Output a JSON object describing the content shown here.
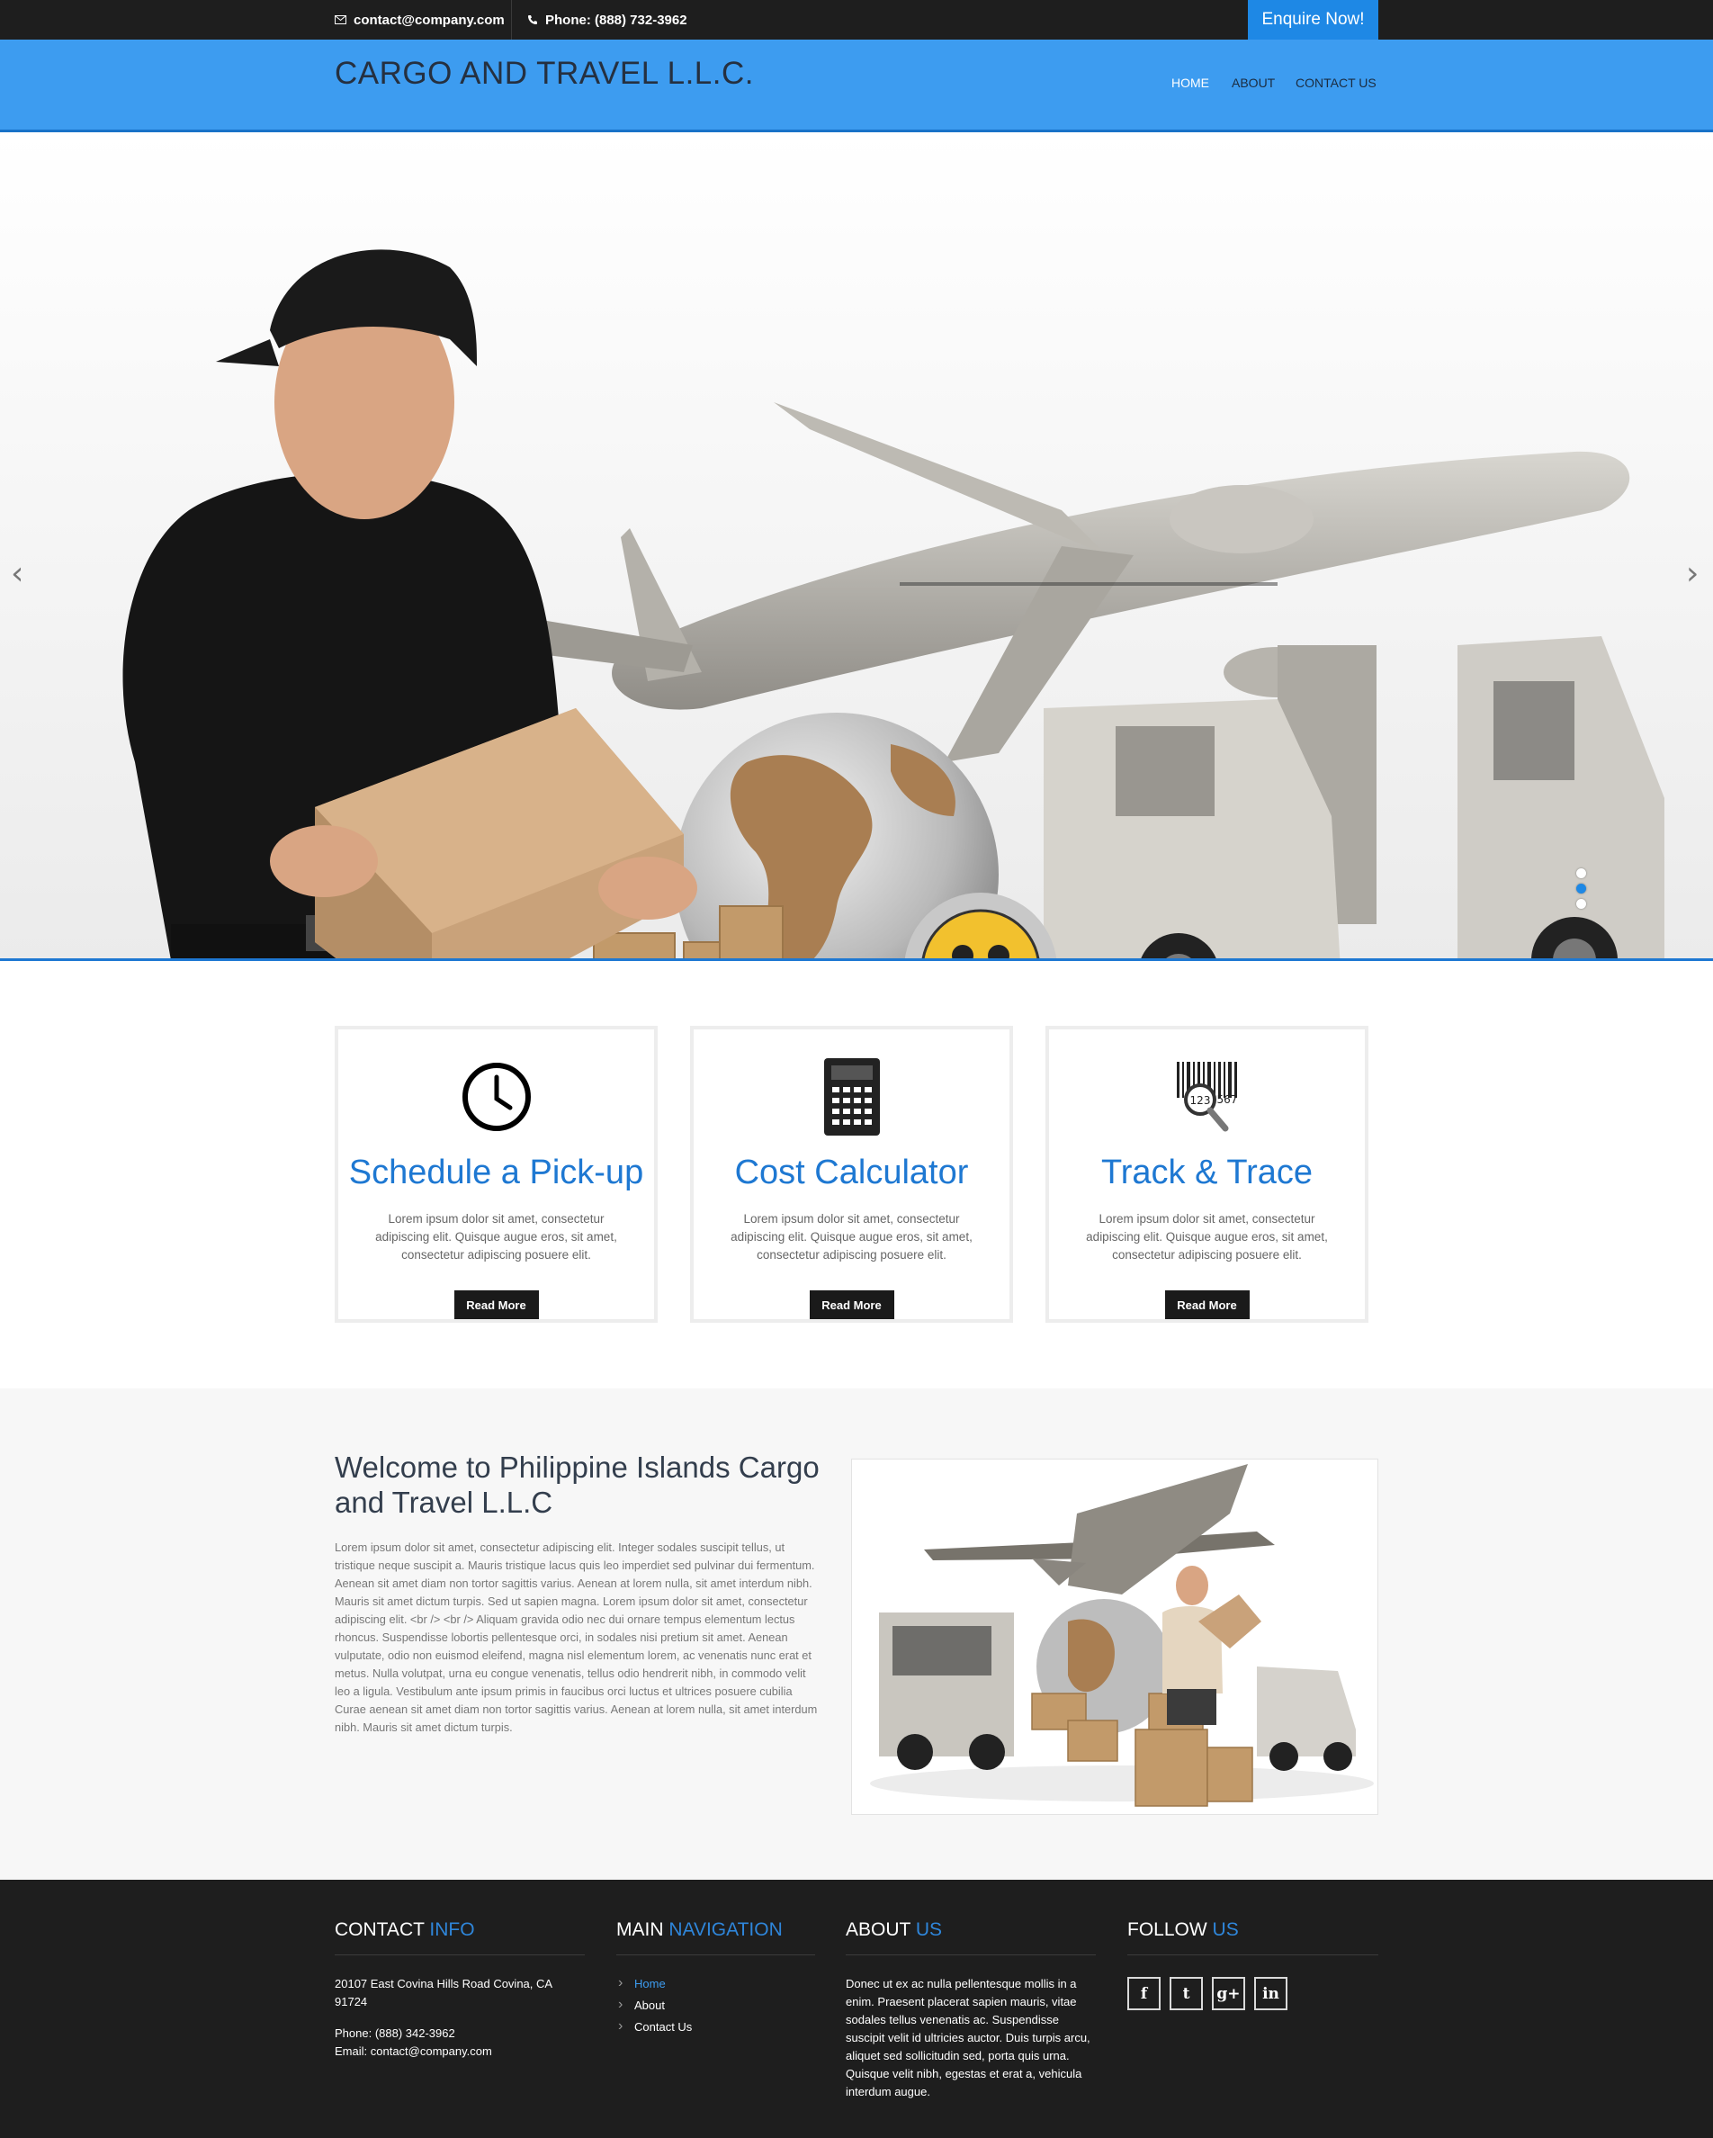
{
  "topbar": {
    "email": "contact@company.com",
    "phone": "Phone: (888) 732-3962",
    "enquire_label": "Enquire Now!"
  },
  "header": {
    "logo": "CARGO AND TRAVEL L.L.C.",
    "nav": [
      {
        "label": "HOME",
        "active": true
      },
      {
        "label": "ABOUT",
        "active": false
      },
      {
        "label": "CONTACT US",
        "active": false
      }
    ]
  },
  "hero": {
    "prev_arrow": "‹",
    "next_arrow": "›",
    "slides": 3,
    "active_slide": 2
  },
  "features": [
    {
      "icon": "clock-icon",
      "title": "Schedule a Pick-up",
      "text": "Lorem ipsum dolor sit amet, consectetur adipiscing elit. Quisque augue eros, sit amet, consectetur adipiscing posuere elit.",
      "button": "Read More"
    },
    {
      "icon": "calculator-icon",
      "title": "Cost Calculator",
      "text": "Lorem ipsum dolor sit amet, consectetur adipiscing elit. Quisque augue eros, sit amet, consectetur adipiscing posuere elit.",
      "button": "Read More"
    },
    {
      "icon": "barcode-search-icon",
      "title": "Track & Trace",
      "text": "Lorem ipsum dolor sit amet, consectetur adipiscing elit. Quisque augue eros, sit amet, consectetur adipiscing posuere elit.",
      "button": "Read More"
    }
  ],
  "welcome": {
    "title": "Welcome to Philippine Islands Cargo and Travel L.L.C",
    "body": "Lorem ipsum dolor sit amet, consectetur adipiscing elit. Integer sodales suscipit tellus, ut tristique neque suscipit a. Mauris tristique lacus quis leo imperdiet sed pulvinar dui fermentum. Aenean sit amet diam non tortor sagittis varius. Aenean at lorem nulla, sit amet interdum nibh. Mauris sit amet dictum turpis. Sed ut sapien magna. Lorem ipsum dolor sit amet, consectetur adipiscing elit. <br /> <br /> Aliquam gravida odio nec dui ornare tempus elementum lectus rhoncus. Suspendisse lobortis pellentesque orci, in sodales nisi pretium sit amet. Aenean vulputate, odio non euismod eleifend, magna nisl elementum lorem, ac venenatis nunc erat et metus. Nulla volutpat, urna eu congue venenatis, tellus odio hendrerit nibh, in commodo velit leo a ligula. Vestibulum ante ipsum primis in faucibus orci luctus et ultrices posuere cubilia Curae aenean sit amet diam non tortor sagittis varius. Aenean at lorem nulla, sit amet interdum nibh. Mauris sit amet dictum turpis."
  },
  "footer": {
    "contact": {
      "title_main": "CONTACT",
      "title_hl": "INFO",
      "address": "20107 East Covina Hills Road Covina, CA 91724",
      "phone": "Phone: (888) 342-3962",
      "email_label": "Email:",
      "email": "contact@company.com"
    },
    "navigation": {
      "title_main": "MAIN",
      "title_hl": "NAVIGATION",
      "items": [
        "Home",
        "About",
        "Contact Us"
      ]
    },
    "about": {
      "title_main": "ABOUT",
      "title_hl": "US",
      "text": "Donec ut ex ac nulla pellentesque mollis in a enim. Praesent placerat sapien mauris, vitae sodales tellus venenatis ac. Suspendisse suscipit velit id ultricies auctor. Duis turpis arcu, aliquet sed sollicitudin sed, porta quis urna. Quisque velit nibh, egestas et erat a, vehicula interdum augue."
    },
    "follow": {
      "title_main": "FOLLOW",
      "title_hl": "US",
      "social": [
        {
          "icon": "facebook-icon",
          "glyph": "f"
        },
        {
          "icon": "twitter-icon",
          "glyph": "t"
        },
        {
          "icon": "google-plus-icon",
          "glyph": "g+"
        },
        {
          "icon": "linkedin-icon",
          "glyph": "in"
        }
      ]
    }
  },
  "colors": {
    "accent": "#1e88e5",
    "header_bg": "#3d9cf0",
    "topbar_bg": "#1e1e1e",
    "footer_bg": "#1e1e1e",
    "feature_title": "#1e78d2"
  }
}
